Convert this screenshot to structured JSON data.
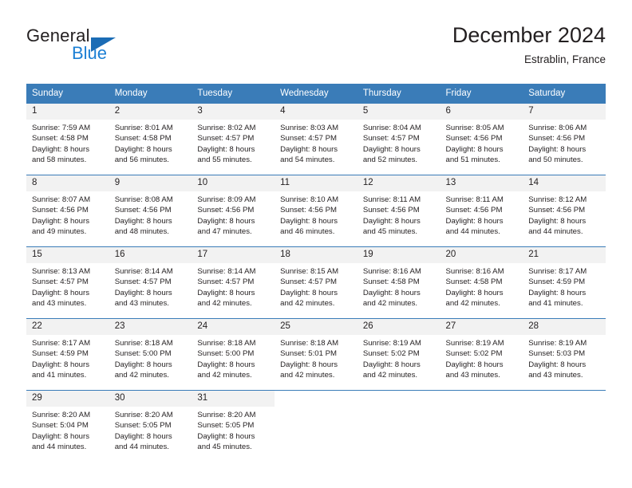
{
  "brand": {
    "name_top": "General",
    "name_bottom": "Blue",
    "triangle_color": "#1b6cb5",
    "blue_text_color": "#1b7fd4"
  },
  "header": {
    "title": "December 2024",
    "location": "Estrablin, France"
  },
  "theme": {
    "header_blue": "#3a7cb8",
    "daynum_bg": "#f2f2f2",
    "text": "#231f20"
  },
  "calendar": {
    "weekday_headers": [
      "Sunday",
      "Monday",
      "Tuesday",
      "Wednesday",
      "Thursday",
      "Friday",
      "Saturday"
    ],
    "weeks": [
      [
        {
          "day": "1",
          "sunrise": "Sunrise: 7:59 AM",
          "sunset": "Sunset: 4:58 PM",
          "daylight1": "Daylight: 8 hours",
          "daylight2": "and 58 minutes."
        },
        {
          "day": "2",
          "sunrise": "Sunrise: 8:01 AM",
          "sunset": "Sunset: 4:58 PM",
          "daylight1": "Daylight: 8 hours",
          "daylight2": "and 56 minutes."
        },
        {
          "day": "3",
          "sunrise": "Sunrise: 8:02 AM",
          "sunset": "Sunset: 4:57 PM",
          "daylight1": "Daylight: 8 hours",
          "daylight2": "and 55 minutes."
        },
        {
          "day": "4",
          "sunrise": "Sunrise: 8:03 AM",
          "sunset": "Sunset: 4:57 PM",
          "daylight1": "Daylight: 8 hours",
          "daylight2": "and 54 minutes."
        },
        {
          "day": "5",
          "sunrise": "Sunrise: 8:04 AM",
          "sunset": "Sunset: 4:57 PM",
          "daylight1": "Daylight: 8 hours",
          "daylight2": "and 52 minutes."
        },
        {
          "day": "6",
          "sunrise": "Sunrise: 8:05 AM",
          "sunset": "Sunset: 4:56 PM",
          "daylight1": "Daylight: 8 hours",
          "daylight2": "and 51 minutes."
        },
        {
          "day": "7",
          "sunrise": "Sunrise: 8:06 AM",
          "sunset": "Sunset: 4:56 PM",
          "daylight1": "Daylight: 8 hours",
          "daylight2": "and 50 minutes."
        }
      ],
      [
        {
          "day": "8",
          "sunrise": "Sunrise: 8:07 AM",
          "sunset": "Sunset: 4:56 PM",
          "daylight1": "Daylight: 8 hours",
          "daylight2": "and 49 minutes."
        },
        {
          "day": "9",
          "sunrise": "Sunrise: 8:08 AM",
          "sunset": "Sunset: 4:56 PM",
          "daylight1": "Daylight: 8 hours",
          "daylight2": "and 48 minutes."
        },
        {
          "day": "10",
          "sunrise": "Sunrise: 8:09 AM",
          "sunset": "Sunset: 4:56 PM",
          "daylight1": "Daylight: 8 hours",
          "daylight2": "and 47 minutes."
        },
        {
          "day": "11",
          "sunrise": "Sunrise: 8:10 AM",
          "sunset": "Sunset: 4:56 PM",
          "daylight1": "Daylight: 8 hours",
          "daylight2": "and 46 minutes."
        },
        {
          "day": "12",
          "sunrise": "Sunrise: 8:11 AM",
          "sunset": "Sunset: 4:56 PM",
          "daylight1": "Daylight: 8 hours",
          "daylight2": "and 45 minutes."
        },
        {
          "day": "13",
          "sunrise": "Sunrise: 8:11 AM",
          "sunset": "Sunset: 4:56 PM",
          "daylight1": "Daylight: 8 hours",
          "daylight2": "and 44 minutes."
        },
        {
          "day": "14",
          "sunrise": "Sunrise: 8:12 AM",
          "sunset": "Sunset: 4:56 PM",
          "daylight1": "Daylight: 8 hours",
          "daylight2": "and 44 minutes."
        }
      ],
      [
        {
          "day": "15",
          "sunrise": "Sunrise: 8:13 AM",
          "sunset": "Sunset: 4:57 PM",
          "daylight1": "Daylight: 8 hours",
          "daylight2": "and 43 minutes."
        },
        {
          "day": "16",
          "sunrise": "Sunrise: 8:14 AM",
          "sunset": "Sunset: 4:57 PM",
          "daylight1": "Daylight: 8 hours",
          "daylight2": "and 43 minutes."
        },
        {
          "day": "17",
          "sunrise": "Sunrise: 8:14 AM",
          "sunset": "Sunset: 4:57 PM",
          "daylight1": "Daylight: 8 hours",
          "daylight2": "and 42 minutes."
        },
        {
          "day": "18",
          "sunrise": "Sunrise: 8:15 AM",
          "sunset": "Sunset: 4:57 PM",
          "daylight1": "Daylight: 8 hours",
          "daylight2": "and 42 minutes."
        },
        {
          "day": "19",
          "sunrise": "Sunrise: 8:16 AM",
          "sunset": "Sunset: 4:58 PM",
          "daylight1": "Daylight: 8 hours",
          "daylight2": "and 42 minutes."
        },
        {
          "day": "20",
          "sunrise": "Sunrise: 8:16 AM",
          "sunset": "Sunset: 4:58 PM",
          "daylight1": "Daylight: 8 hours",
          "daylight2": "and 42 minutes."
        },
        {
          "day": "21",
          "sunrise": "Sunrise: 8:17 AM",
          "sunset": "Sunset: 4:59 PM",
          "daylight1": "Daylight: 8 hours",
          "daylight2": "and 41 minutes."
        }
      ],
      [
        {
          "day": "22",
          "sunrise": "Sunrise: 8:17 AM",
          "sunset": "Sunset: 4:59 PM",
          "daylight1": "Daylight: 8 hours",
          "daylight2": "and 41 minutes."
        },
        {
          "day": "23",
          "sunrise": "Sunrise: 8:18 AM",
          "sunset": "Sunset: 5:00 PM",
          "daylight1": "Daylight: 8 hours",
          "daylight2": "and 42 minutes."
        },
        {
          "day": "24",
          "sunrise": "Sunrise: 8:18 AM",
          "sunset": "Sunset: 5:00 PM",
          "daylight1": "Daylight: 8 hours",
          "daylight2": "and 42 minutes."
        },
        {
          "day": "25",
          "sunrise": "Sunrise: 8:18 AM",
          "sunset": "Sunset: 5:01 PM",
          "daylight1": "Daylight: 8 hours",
          "daylight2": "and 42 minutes."
        },
        {
          "day": "26",
          "sunrise": "Sunrise: 8:19 AM",
          "sunset": "Sunset: 5:02 PM",
          "daylight1": "Daylight: 8 hours",
          "daylight2": "and 42 minutes."
        },
        {
          "day": "27",
          "sunrise": "Sunrise: 8:19 AM",
          "sunset": "Sunset: 5:02 PM",
          "daylight1": "Daylight: 8 hours",
          "daylight2": "and 43 minutes."
        },
        {
          "day": "28",
          "sunrise": "Sunrise: 8:19 AM",
          "sunset": "Sunset: 5:03 PM",
          "daylight1": "Daylight: 8 hours",
          "daylight2": "and 43 minutes."
        }
      ],
      [
        {
          "day": "29",
          "sunrise": "Sunrise: 8:20 AM",
          "sunset": "Sunset: 5:04 PM",
          "daylight1": "Daylight: 8 hours",
          "daylight2": "and 44 minutes."
        },
        {
          "day": "30",
          "sunrise": "Sunrise: 8:20 AM",
          "sunset": "Sunset: 5:05 PM",
          "daylight1": "Daylight: 8 hours",
          "daylight2": "and 44 minutes."
        },
        {
          "day": "31",
          "sunrise": "Sunrise: 8:20 AM",
          "sunset": "Sunset: 5:05 PM",
          "daylight1": "Daylight: 8 hours",
          "daylight2": "and 45 minutes."
        },
        {
          "day": "",
          "sunrise": "",
          "sunset": "",
          "daylight1": "",
          "daylight2": ""
        },
        {
          "day": "",
          "sunrise": "",
          "sunset": "",
          "daylight1": "",
          "daylight2": ""
        },
        {
          "day": "",
          "sunrise": "",
          "sunset": "",
          "daylight1": "",
          "daylight2": ""
        },
        {
          "day": "",
          "sunrise": "",
          "sunset": "",
          "daylight1": "",
          "daylight2": ""
        }
      ]
    ]
  }
}
